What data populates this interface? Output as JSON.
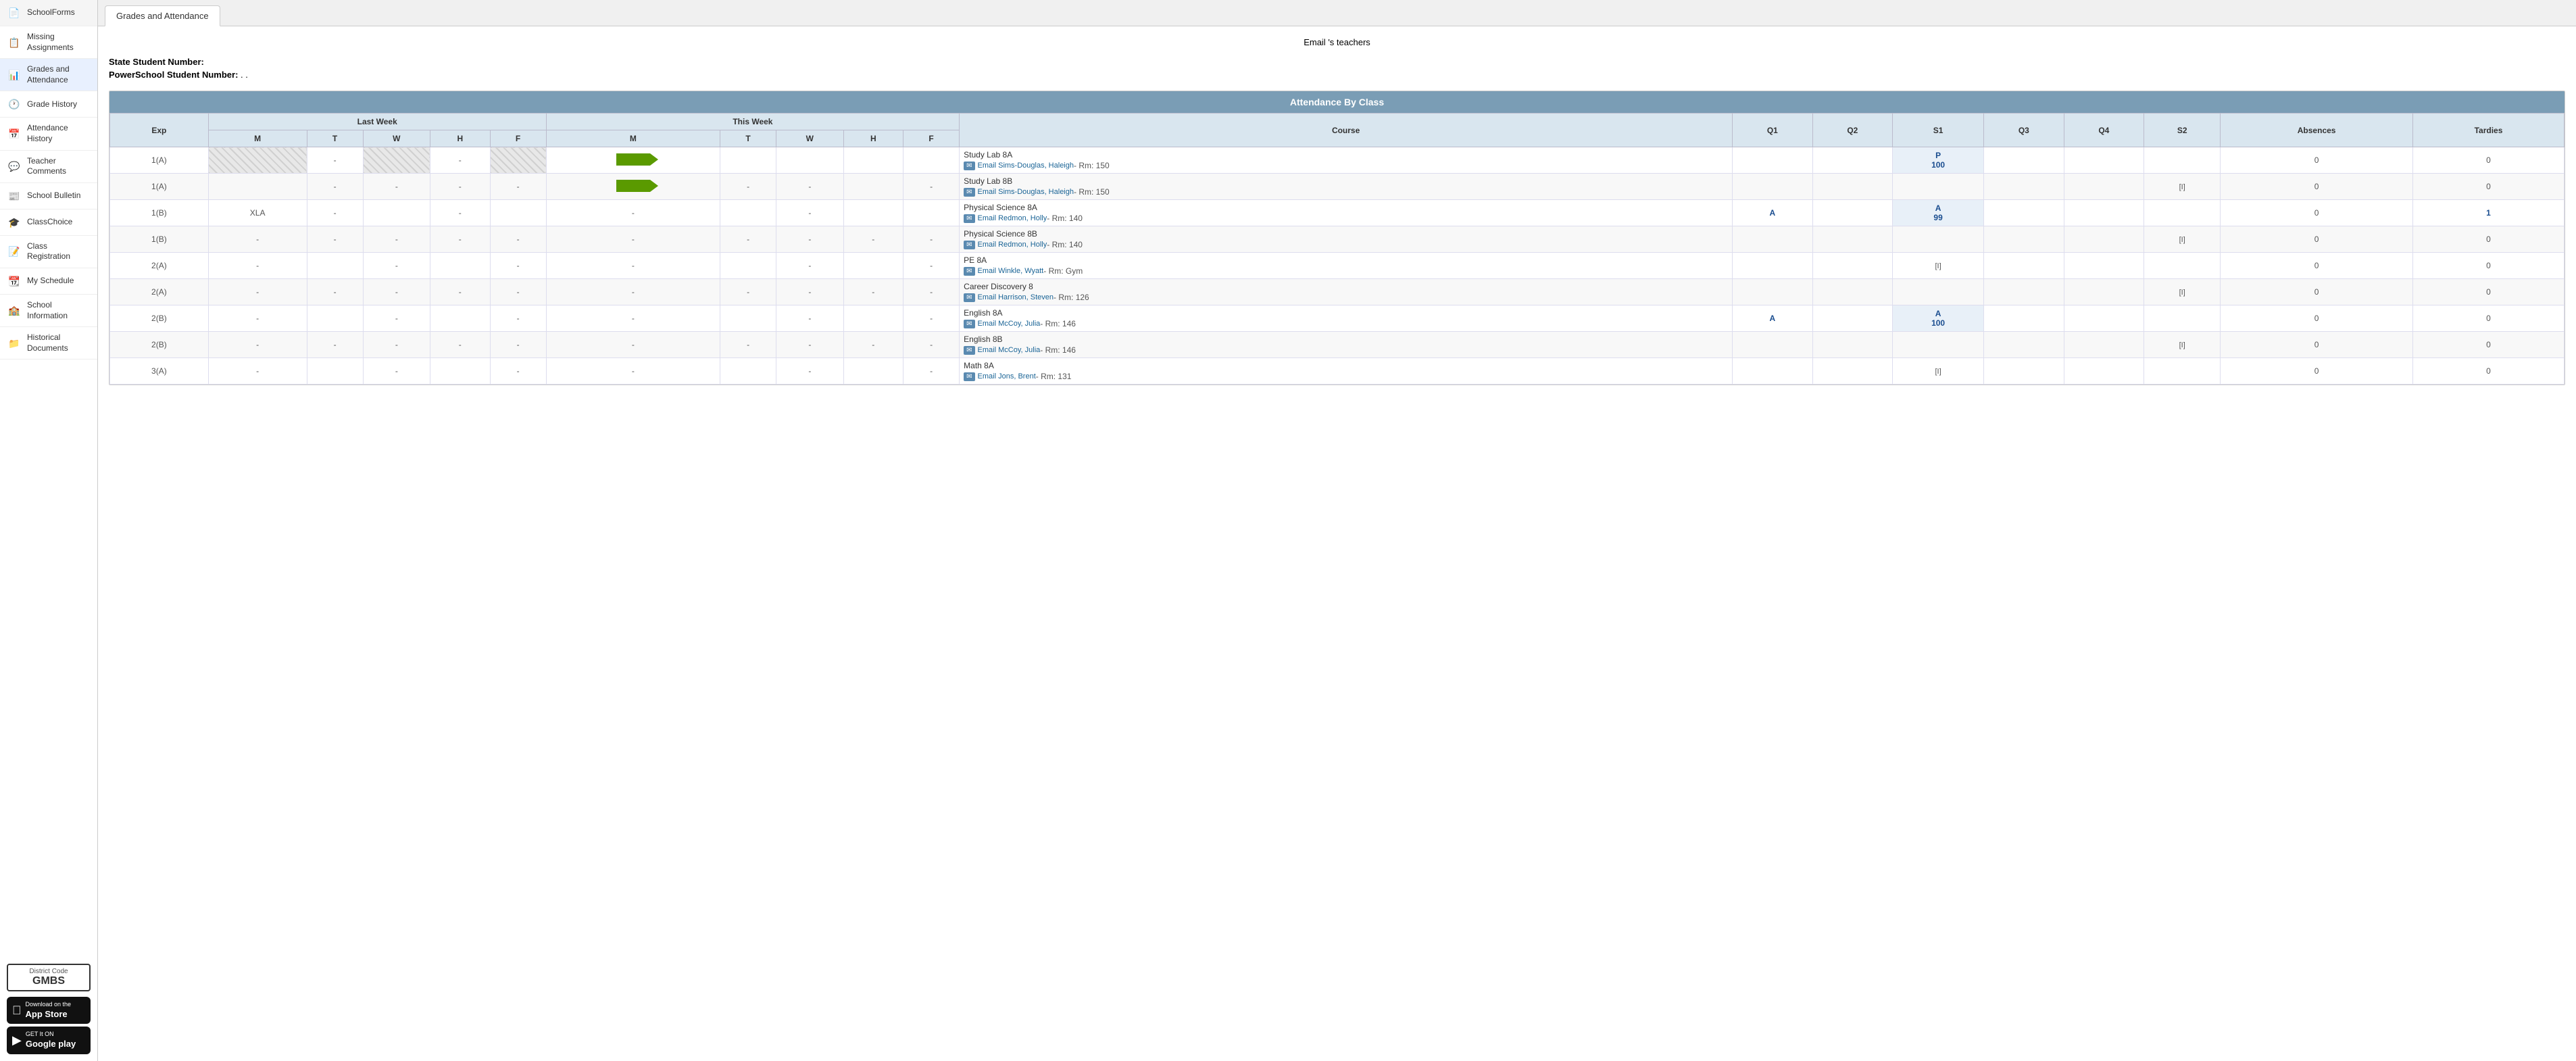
{
  "sidebar": {
    "items": [
      {
        "id": "school-forms",
        "label": "SchoolForms",
        "icon": "📄"
      },
      {
        "id": "missing-assignments",
        "label": "Missing Assignments",
        "icon": "📋"
      },
      {
        "id": "grades-attendance",
        "label": "Grades and Attendance",
        "icon": "📊",
        "active": true
      },
      {
        "id": "grade-history",
        "label": "Grade History",
        "icon": "🕐"
      },
      {
        "id": "attendance-history",
        "label": "Attendance History",
        "icon": "📅"
      },
      {
        "id": "teacher-comments",
        "label": "Teacher Comments",
        "icon": "💬"
      },
      {
        "id": "school-bulletin",
        "label": "School Bulletin",
        "icon": "📰"
      },
      {
        "id": "class-choice",
        "label": "ClassChoice",
        "icon": "🎓"
      },
      {
        "id": "class-registration",
        "label": "Class Registration",
        "icon": "📝"
      },
      {
        "id": "my-schedule",
        "label": "My Schedule",
        "icon": "📆"
      },
      {
        "id": "school-information",
        "label": "School Information",
        "icon": "🏫"
      },
      {
        "id": "historical-documents",
        "label": "Historical Documents",
        "icon": "📁"
      }
    ],
    "district_code_label": "District Code",
    "district_code": "GMBS",
    "app_store_label": "Download on the App Store",
    "google_play_label": "GET It ON Google play"
  },
  "tab": {
    "label": "Grades and Attendance"
  },
  "content": {
    "email_prefix": "Email",
    "email_suffix": "'s teachers",
    "student_state_number_label": "State Student Number:",
    "student_state_number_value": "",
    "student_ps_number_label": "PowerSchool Student Number:",
    "student_ps_number_value": ". .",
    "attendance_section_title": "Attendance By Class",
    "col_exp": "Exp",
    "col_m": "M",
    "col_t": "T",
    "col_w": "W",
    "col_h": "H",
    "col_f": "F",
    "col_course": "Course",
    "col_q1": "Q1",
    "col_q2": "Q2",
    "col_s1": "S1",
    "col_q3": "Q3",
    "col_q4": "Q4",
    "col_s2": "S2",
    "col_absences": "Absences",
    "col_tardies": "Tardies",
    "last_week_label": "Last Week",
    "this_week_label": "This Week",
    "rows": [
      {
        "exp": "1(A)",
        "lw_m": "",
        "lw_t": "-",
        "lw_w": "",
        "lw_h": "-",
        "lw_f": "",
        "tw_m": "-",
        "tw_t": "",
        "tw_w": "",
        "tw_h": "",
        "tw_f": "",
        "course_name": "Study Lab 8A",
        "teacher": "Email Sims-Douglas, Haleigh",
        "room": "Rm: 150",
        "q1": "",
        "q2": "",
        "s1": "P\n100",
        "q3": "",
        "q4": "",
        "s2": "",
        "absences": "0",
        "tardies": "0",
        "has_arrow": true,
        "hatch_lw": true,
        "hatch_tw": false
      },
      {
        "exp": "1(A)",
        "lw_m": "",
        "lw_t": "-",
        "lw_w": "-",
        "lw_h": "-",
        "lw_f": "-",
        "tw_m": "-",
        "tw_t": "-",
        "tw_w": "-",
        "tw_h": "",
        "tw_f": "-",
        "course_name": "Study Lab 8B",
        "teacher": "Email Sims-Douglas, Haleigh",
        "room": "Rm: 150",
        "q1": "",
        "q2": "",
        "s1": "",
        "q3": "",
        "q4": "",
        "s2": "[I]",
        "absences": "0",
        "tardies": "0",
        "has_arrow": true,
        "hatch_lw": false,
        "hatch_tw": false
      },
      {
        "exp": "1(B)",
        "lw_m": "XLA",
        "lw_t": "-",
        "lw_w": "",
        "lw_h": "-",
        "lw_f": "",
        "tw_m": "-",
        "tw_t": "",
        "tw_w": "-",
        "tw_h": "",
        "tw_f": "",
        "course_name": "Physical Science 8A",
        "teacher": "Email Redmon, Holly",
        "room": "Rm: 140",
        "q1": "A",
        "q2": "",
        "s1": "A\n99",
        "q3": "",
        "q4": "",
        "s2": "",
        "absences": "0",
        "tardies": "1",
        "has_arrow": false,
        "hatch_lw": false,
        "hatch_tw": false
      },
      {
        "exp": "1(B)",
        "lw_m": "-",
        "lw_t": "-",
        "lw_w": "-",
        "lw_h": "-",
        "lw_f": "-",
        "tw_m": "-",
        "tw_t": "-",
        "tw_w": "-",
        "tw_h": "-",
        "tw_f": "-",
        "course_name": "Physical Science 8B",
        "teacher": "Email Redmon, Holly",
        "room": "Rm: 140",
        "q1": "",
        "q2": "",
        "s1": "",
        "q3": "",
        "q4": "",
        "s2": "[I]",
        "absences": "0",
        "tardies": "0",
        "has_arrow": false,
        "hatch_lw": false,
        "hatch_tw": false
      },
      {
        "exp": "2(A)",
        "lw_m": "-",
        "lw_t": "",
        "lw_w": "-",
        "lw_h": "",
        "lw_f": "-",
        "tw_m": "-",
        "tw_t": "",
        "tw_w": "-",
        "tw_h": "",
        "tw_f": "-",
        "course_name": "PE 8A",
        "teacher": "Email Winkle, Wyatt",
        "room": "Rm: Gym",
        "q1": "",
        "q2": "",
        "s1": "[I]",
        "q3": "",
        "q4": "",
        "s2": "",
        "absences": "0",
        "tardies": "0",
        "has_arrow": false,
        "hatch_lw": false,
        "hatch_tw": false
      },
      {
        "exp": "2(A)",
        "lw_m": "-",
        "lw_t": "-",
        "lw_w": "-",
        "lw_h": "-",
        "lw_f": "-",
        "tw_m": "-",
        "tw_t": "-",
        "tw_w": "-",
        "tw_h": "-",
        "tw_f": "-",
        "course_name": "Career Discovery 8",
        "teacher": "Email Harrison, Steven",
        "room": "Rm: 126",
        "q1": "",
        "q2": "",
        "s1": "",
        "q3": "",
        "q4": "",
        "s2": "[I]",
        "absences": "0",
        "tardies": "0",
        "has_arrow": false,
        "hatch_lw": false,
        "hatch_tw": false
      },
      {
        "exp": "2(B)",
        "lw_m": "-",
        "lw_t": "",
        "lw_w": "-",
        "lw_h": "",
        "lw_f": "-",
        "tw_m": "-",
        "tw_t": "",
        "tw_w": "-",
        "tw_h": "",
        "tw_f": "-",
        "course_name": "English 8A",
        "teacher": "Email McCoy, Julia",
        "room": "Rm: 146",
        "q1": "A",
        "q2": "",
        "s1": "A\n100",
        "q3": "",
        "q4": "",
        "s2": "",
        "absences": "0",
        "tardies": "0",
        "has_arrow": false,
        "hatch_lw": false,
        "hatch_tw": false
      },
      {
        "exp": "2(B)",
        "lw_m": "-",
        "lw_t": "-",
        "lw_w": "-",
        "lw_h": "-",
        "lw_f": "-",
        "tw_m": "-",
        "tw_t": "-",
        "tw_w": "-",
        "tw_h": "-",
        "tw_f": "-",
        "course_name": "English 8B",
        "teacher": "Email McCoy, Julia",
        "room": "Rm: 146",
        "q1": "",
        "q2": "",
        "s1": "",
        "q3": "",
        "q4": "",
        "s2": "[I]",
        "absences": "0",
        "tardies": "0",
        "has_arrow": false,
        "hatch_lw": false,
        "hatch_tw": false
      },
      {
        "exp": "3(A)",
        "lw_m": "-",
        "lw_t": "",
        "lw_w": "-",
        "lw_h": "",
        "lw_f": "-",
        "tw_m": "-",
        "tw_t": "",
        "tw_w": "-",
        "tw_h": "",
        "tw_f": "-",
        "course_name": "Math 8A",
        "teacher": "Email Jons, Brent",
        "room": "Rm: 131",
        "q1": "",
        "q2": "",
        "s1": "[I]",
        "q3": "",
        "q4": "",
        "s2": "",
        "absences": "0",
        "tardies": "0",
        "has_arrow": false,
        "hatch_lw": false,
        "hatch_tw": false
      }
    ]
  }
}
